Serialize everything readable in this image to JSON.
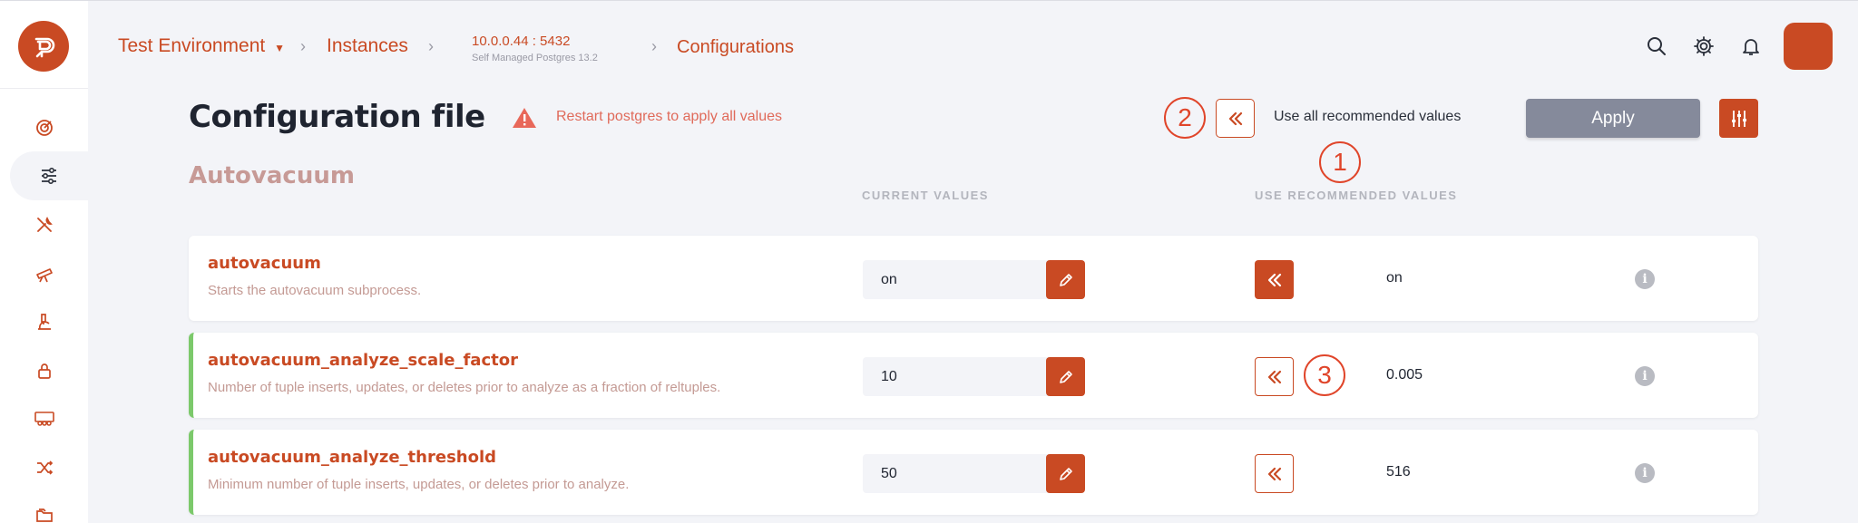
{
  "header": {
    "environment": "Test Environment",
    "instances": "Instances",
    "instance_address": "10.0.0.44 : 5432",
    "instance_type": "Self Managed Postgres 13.2",
    "current_page": "Configurations"
  },
  "page": {
    "title": "Configuration file",
    "warning": "Restart postgres to apply all values",
    "use_all_recommended": "Use all recommended values",
    "apply_label": "Apply"
  },
  "callouts": {
    "one": "1",
    "two": "2",
    "three": "3"
  },
  "section": {
    "title": "Autovacuum",
    "current_values_header": "CURRENT VALUES",
    "recommended_values_header": "USE RECOMMENDED VALUES"
  },
  "rows": [
    {
      "name": "autovacuum",
      "description": "Starts the autovacuum subprocess.",
      "current": "on",
      "recommended": "on",
      "modified": false,
      "applied": true
    },
    {
      "name": "autovacuum_analyze_scale_factor",
      "description": "Number of tuple inserts, updates, or deletes prior to analyze as a fraction of reltuples.",
      "current": "10",
      "recommended": "0.005",
      "modified": true,
      "applied": false
    },
    {
      "name": "autovacuum_analyze_threshold",
      "description": "Minimum number of tuple inserts, updates, or deletes prior to analyze.",
      "current": "50",
      "recommended": "516",
      "modified": true,
      "applied": false
    }
  ],
  "icons": {
    "sidebar": [
      "dashboard-icon",
      "sliders-icon",
      "tools-icon",
      "telescope-icon",
      "microscope-icon",
      "lock-icon",
      "team-icon",
      "shuffle-icon",
      "folders-icon"
    ],
    "header": [
      "search-icon",
      "gear-icon",
      "bell-icon"
    ]
  },
  "colors": {
    "accent": "#c94a23",
    "modified": "#7cc96b",
    "callout": "#e0452a"
  }
}
